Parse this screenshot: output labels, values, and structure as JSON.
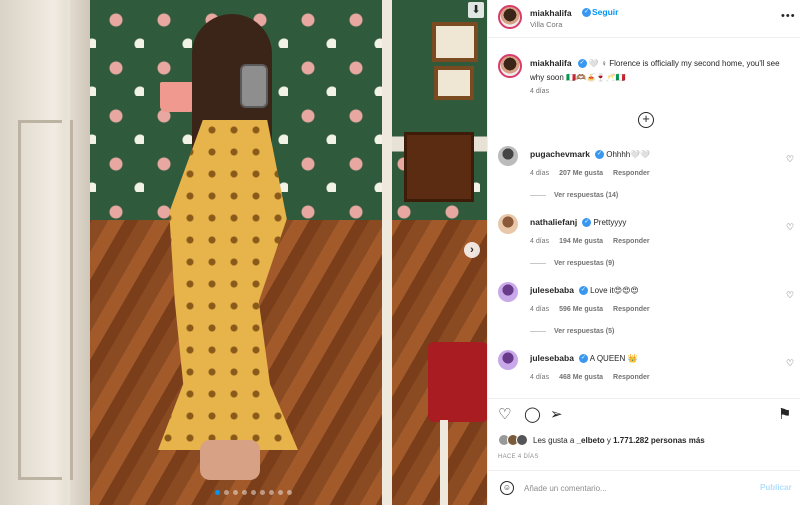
{
  "post": {
    "username": "miakhalifa",
    "follow_label": "Seguir",
    "location": "Villa Cora",
    "more_icon": "more-horizontal-icon",
    "caption": {
      "username": "miakhalifa",
      "text": "🤍 ♀ Florence is officially my second home, you'll see why soon 🇮🇹🫶🏽🍝🍷🥂🇮🇹",
      "time": "4 días"
    },
    "load_more_icon": "plus-circle-icon"
  },
  "comments": [
    {
      "username": "pugachevmark",
      "text": "Ohhhh🤍🤍",
      "time": "4 días",
      "likes": "207 Me gusta",
      "reply_label": "Responder",
      "view_replies": "Ver respuestas (14)"
    },
    {
      "username": "nathaliefanj",
      "text": "Prettyyyy",
      "time": "4 días",
      "likes": "194 Me gusta",
      "reply_label": "Responder",
      "view_replies": "Ver respuestas (9)"
    },
    {
      "username": "julesebaba",
      "text": "Love it😍😍😍",
      "time": "4 días",
      "likes": "596 Me gusta",
      "reply_label": "Responder",
      "view_replies": "Ver respuestas (5)"
    },
    {
      "username": "julesebaba",
      "text": "A QUEEN 👑",
      "time": "4 días",
      "likes": "468 Me gusta",
      "reply_label": "Responder",
      "view_replies": ""
    }
  ],
  "actions": {
    "like_icon": "heart-icon",
    "comment_icon": "comment-icon",
    "share_icon": "send-icon",
    "save_icon": "bookmark-icon"
  },
  "likes_summary": {
    "prefix": "Les gusta a",
    "user": "_elbeto",
    "middle": "y",
    "count": "1.771.282 personas más"
  },
  "posted_time": "HACE 4 DÍAS",
  "add_comment": {
    "placeholder": "Añade un comentario...",
    "publish_label": "Publicar"
  },
  "carousel": {
    "total": 9,
    "active": 1
  },
  "colors": {
    "accent": "#0095f6",
    "verified": "#3897f0",
    "text": "#262626",
    "muted": "#737373"
  }
}
